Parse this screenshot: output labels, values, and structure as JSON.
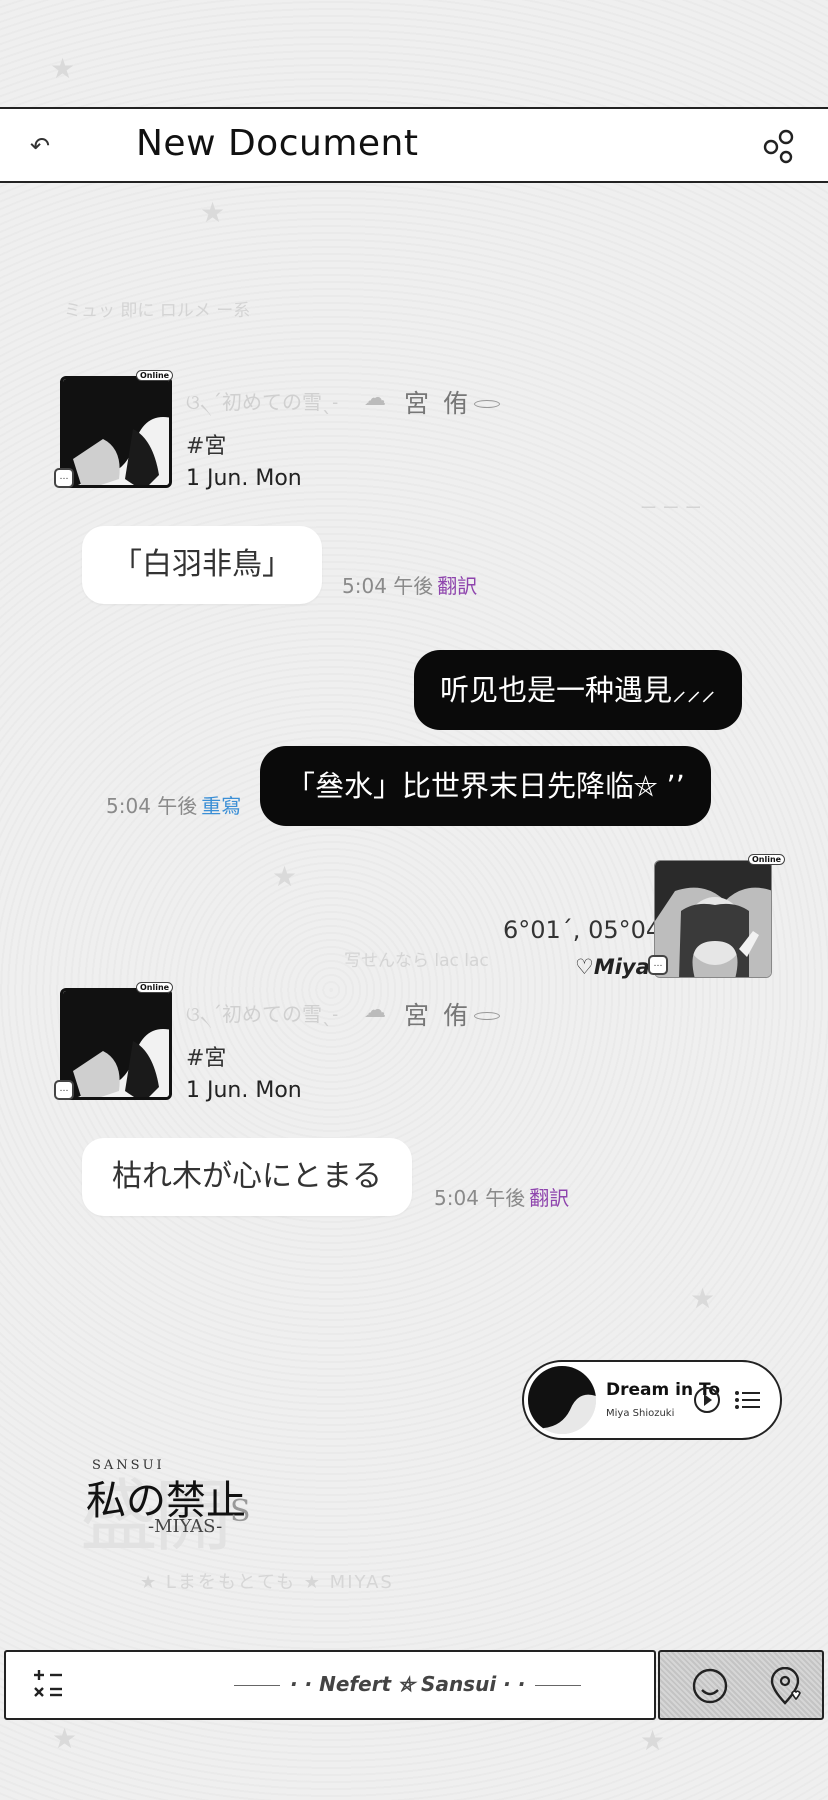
{
  "header": {
    "back_icon": "↶",
    "title": "New Document",
    "menu_icon": "menu-circles-icon"
  },
  "decor": {
    "faint_top": "ミュッ 即に ロルメ ー系",
    "faint_mid": "写せんなら  lac lac",
    "faint_bottom": "★ Lまをもとても  ★  MIYAS"
  },
  "profile": {
    "online": "Online",
    "handle": "ଓ৲ˊ初めての雪ˎ˗",
    "cloud": "☁",
    "name": "宮 侑",
    "tag": "#宮",
    "date": "1 Jun. Mon"
  },
  "messages": {
    "m1": {
      "text": "「白羽非鳥」",
      "time": "5:04 午後",
      "action": "翻訳"
    },
    "m2": {
      "text": "听见也是一种遇見⸝⸝⸝"
    },
    "m3": {
      "text": "「叄水」比世界末日先降临⛤ ՚՚",
      "time": "5:04 午後",
      "action": "重寫"
    },
    "m4": {
      "text": "枯れ木が心にとまる",
      "time": "5:04 午後",
      "action": "翻訳"
    }
  },
  "photo_block": {
    "coords": "6°01ˊ, 05°04",
    "label": "♡Miya",
    "online": "Online"
  },
  "player": {
    "song": "Dream in To",
    "artist": "Miya Shiozuki"
  },
  "logo": {
    "small": "SANSUI",
    "main": "私の禁止",
    "sub": "-MIYAS-",
    "s": "S",
    "ghost": "盛開"
  },
  "bottom_bar": {
    "signature": "· · Nefert ⛤ Sansui · ·"
  }
}
